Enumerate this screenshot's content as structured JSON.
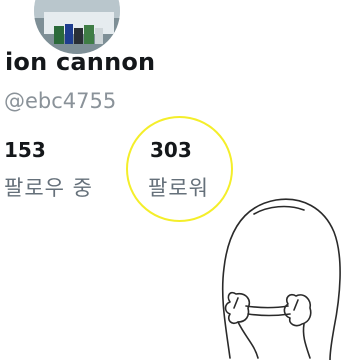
{
  "profile": {
    "display_name": "ion cannon",
    "handle": "@ebc4755"
  },
  "stats": {
    "following": {
      "count": "153",
      "label": "팔로우 중"
    },
    "followers": {
      "count": "303",
      "label": "팔로워"
    }
  },
  "colors": {
    "highlight": "#f4ee2a",
    "name_text": "#14171a",
    "secondary_text": "#65707a"
  }
}
